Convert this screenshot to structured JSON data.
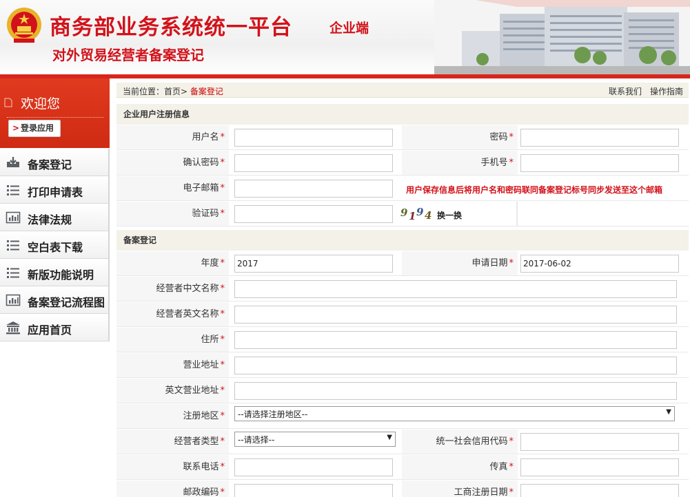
{
  "header": {
    "title": "商务部业务系统统一平台",
    "tag": "企业端",
    "subtitle": "对外贸易经营者备案登记"
  },
  "colors": {
    "brand_red": "#d2121a",
    "sidebar_red": "#d9301a"
  },
  "sidebar": {
    "welcome": "欢迎您",
    "login_button": "登录应用",
    "items": [
      {
        "label": "备案登记",
        "icon": "download-tray-icon"
      },
      {
        "label": "打印申请表",
        "icon": "list-icon"
      },
      {
        "label": "法律法规",
        "icon": "bar-chart-icon"
      },
      {
        "label": "空白表下载",
        "icon": "list-icon"
      },
      {
        "label": "新版功能说明",
        "icon": "list-icon"
      },
      {
        "label": "备案登记流程图",
        "icon": "bar-chart-icon"
      },
      {
        "label": "应用首页",
        "icon": "building-icon"
      }
    ]
  },
  "breadcrumb": {
    "prefix": "当前位置：",
    "home": "首页",
    "sep": "> ",
    "current": "备案登记"
  },
  "top_links": {
    "contact": "联系我们",
    "guide": "操作指南"
  },
  "section_user": {
    "title": "企业用户注册信息",
    "username_label": "用户名",
    "password_label": "密码",
    "confirm_label": "确认密码",
    "phone_label": "手机号",
    "email_label": "电子邮箱",
    "email_notice": "用户保存信息后将用户名和密码联同备案登记标号同步发送至这个邮箱",
    "captcha_label": "验证码",
    "captcha_chars": [
      "9",
      "1",
      "9",
      "4"
    ],
    "refresh_label": "换一换"
  },
  "section_record": {
    "title": "备案登记",
    "year_label": "年度",
    "year_value": "2017",
    "apply_date_label": "申请日期",
    "apply_date_value": "2017-06-02",
    "cn_name_label": "经营者中文名称",
    "en_name_label": "经营者英文名称",
    "residence_label": "住所",
    "biz_addr_label": "营业地址",
    "en_biz_addr_label": "英文营业地址",
    "region_label": "注册地区",
    "region_value": "--请选择注册地区--",
    "type_label": "经营者类型",
    "type_value": "--请选择--",
    "credit_code_label": "统一社会信用代码",
    "tel_label": "联系电话",
    "fax_label": "传真",
    "postcode_label": "邮政编码",
    "biz_reg_date_label": "工商注册日期"
  }
}
